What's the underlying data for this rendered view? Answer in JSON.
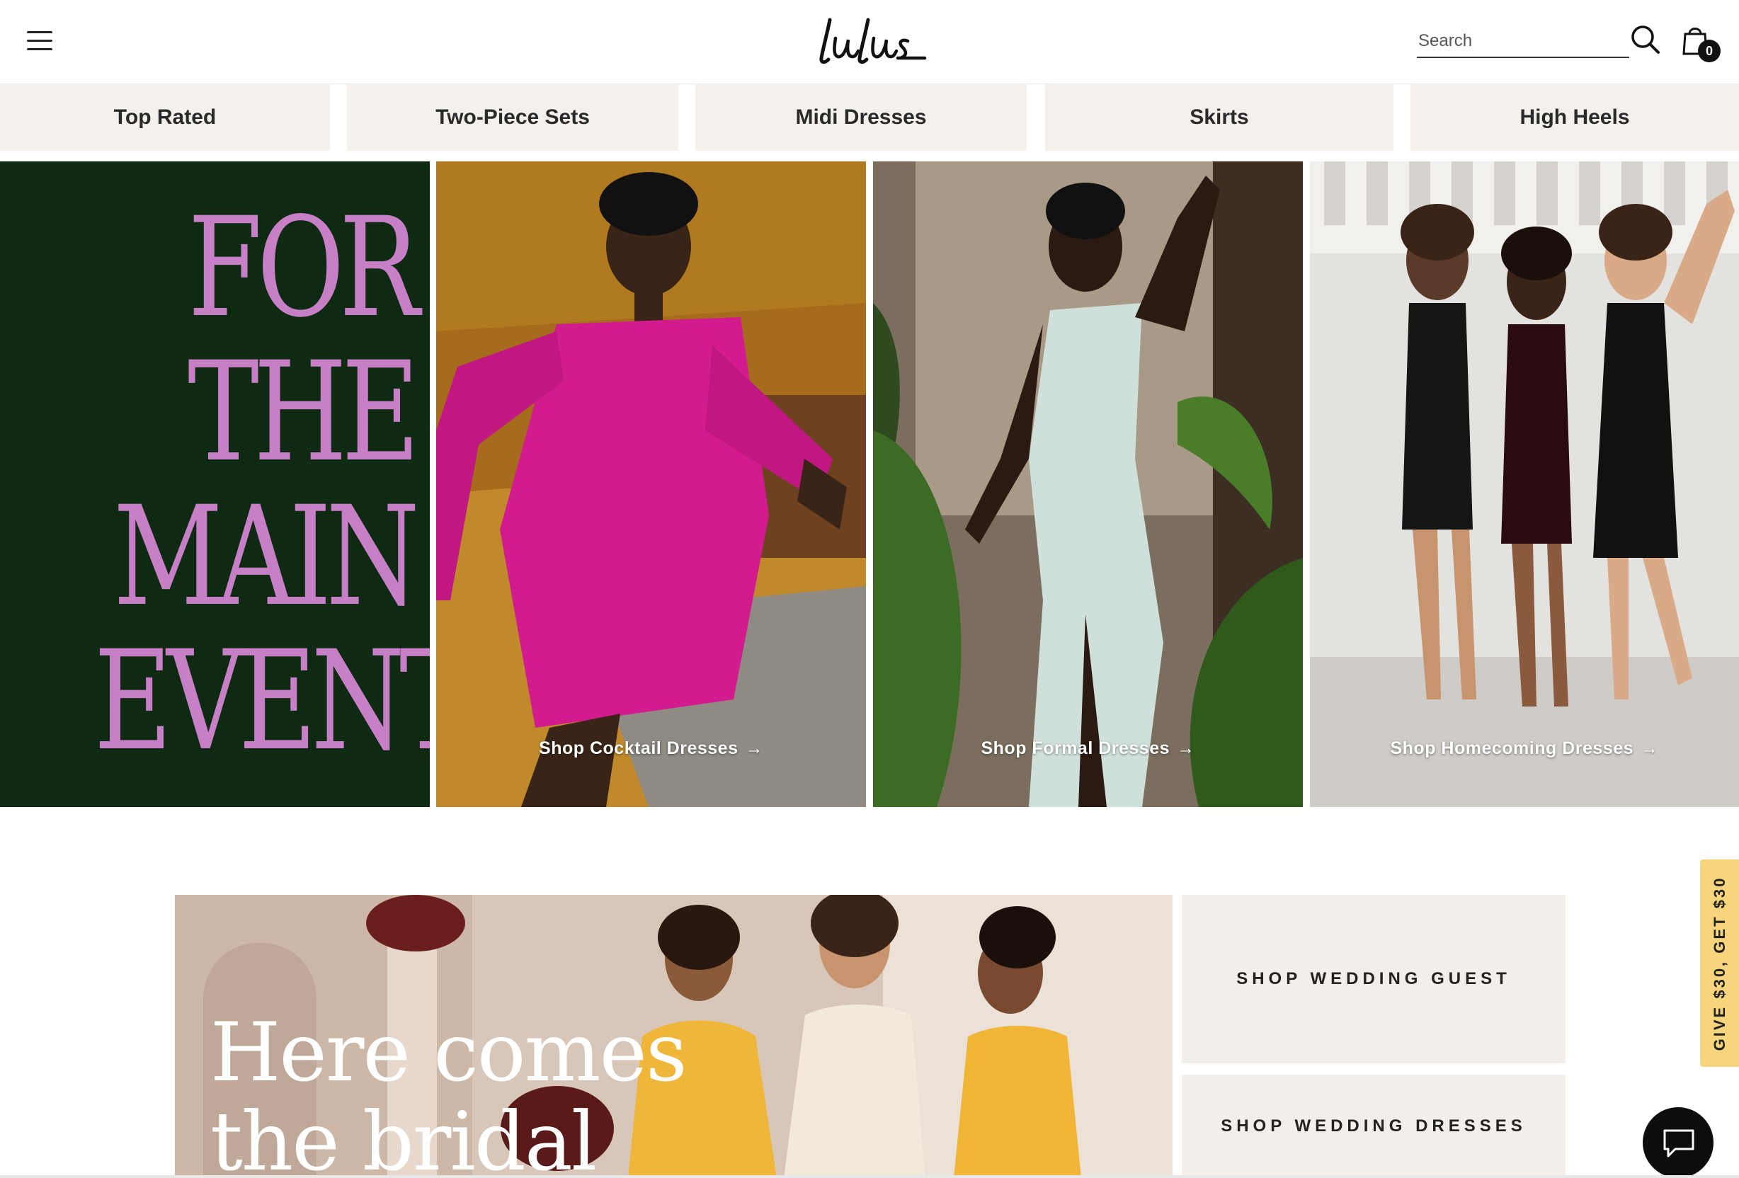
{
  "header": {
    "logo_text": "Lulus",
    "search_placeholder": "Search",
    "cart_count": "0"
  },
  "categories": [
    "Top Rated",
    "Two-Piece Sets",
    "Midi Dresses",
    "Skirts",
    "High Heels"
  ],
  "hero": {
    "headline_lines": [
      "FOR",
      "THE",
      "MAIN",
      "EVENT"
    ],
    "ctas": [
      {
        "label": "Shop Cocktail Dresses",
        "arrow": "→"
      },
      {
        "label": "Shop Formal Dresses",
        "arrow": "→"
      },
      {
        "label": "Shop Homecoming Dresses",
        "arrow": "→"
      }
    ]
  },
  "bridal": {
    "headline_lines": [
      "Here comes",
      "the bridal"
    ],
    "links": [
      "SHOP WEDDING GUEST",
      "SHOP WEDDING DRESSES"
    ]
  },
  "referral": {
    "label": "GIVE $30, GET $30"
  },
  "colors": {
    "hero_panel": "#0f2a12",
    "hero_text": "#c77fc6",
    "category_bg": "#f4f1ec",
    "referral_bg": "#f7d57c",
    "chat_bg": "#0d0d0d"
  },
  "icons": [
    "hamburger-menu-icon",
    "search-icon",
    "shopping-bag-icon",
    "arrow-right-icon",
    "chat-icon"
  ]
}
